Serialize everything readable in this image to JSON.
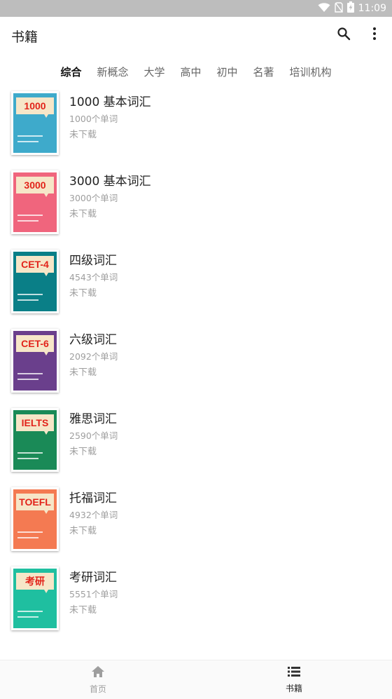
{
  "status_bar": {
    "time": "11:09",
    "icons": [
      "wifi-icon",
      "no-sim-icon",
      "battery-charging-icon"
    ]
  },
  "app_bar": {
    "title": "书籍",
    "actions": [
      "search-icon",
      "more-vert-icon"
    ]
  },
  "tabs": [
    {
      "label": "综合",
      "active": true
    },
    {
      "label": "新概念",
      "active": false
    },
    {
      "label": "大学",
      "active": false
    },
    {
      "label": "高中",
      "active": false
    },
    {
      "label": "初中",
      "active": false
    },
    {
      "label": "名著",
      "active": false
    },
    {
      "label": "培训机构",
      "active": false
    }
  ],
  "books": [
    {
      "cover_text": "1000",
      "cover_color": "#3eaacb",
      "title": "1000 基本词汇",
      "count": "1000个单词",
      "status": "未下载"
    },
    {
      "cover_text": "3000",
      "cover_color": "#f0657d",
      "title": "3000 基本词汇",
      "count": "3000个单词",
      "status": "未下载"
    },
    {
      "cover_text": "CET-4",
      "cover_color": "#0a7f87",
      "title": "四级词汇",
      "count": "4543个单词",
      "status": "未下载"
    },
    {
      "cover_text": "CET-6",
      "cover_color": "#6a3f8c",
      "title": "六级词汇",
      "count": "2092个单词",
      "status": "未下载"
    },
    {
      "cover_text": "IELTS",
      "cover_color": "#1a8a57",
      "title": "雅思词汇",
      "count": "2590个单词",
      "status": "未下载"
    },
    {
      "cover_text": "TOEFL",
      "cover_color": "#f47a52",
      "title": "托福词汇",
      "count": "4932个单词",
      "status": "未下载"
    },
    {
      "cover_text": "考研",
      "cover_color": "#1fbfa0",
      "title": "考研词汇",
      "count": "5551个单词",
      "status": "未下载"
    }
  ],
  "bottom_nav": [
    {
      "label": "首页",
      "icon": "home-icon",
      "active": false
    },
    {
      "label": "书籍",
      "icon": "list-icon",
      "active": true
    }
  ],
  "colors": {
    "status_bar_bg": "#bdbdbd",
    "cover_tag_bg": "#f6e6c8",
    "cover_tag_text": "#e2231a",
    "secondary_text": "#9e9e9e"
  }
}
